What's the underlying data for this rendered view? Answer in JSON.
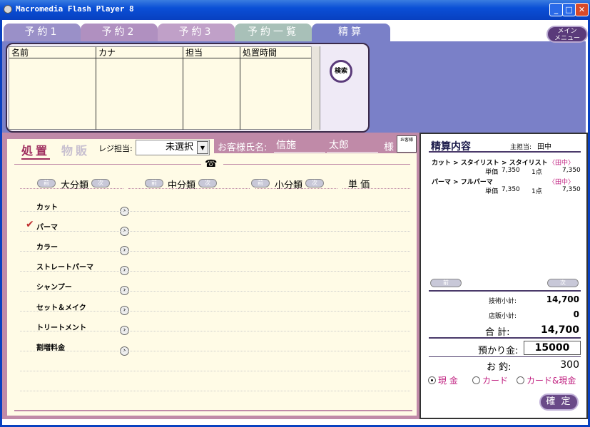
{
  "window": {
    "title": "Macromedia Flash Player 8"
  },
  "tabs": [
    "予約1",
    "予約2",
    "予約3",
    "予約一覧",
    "精算"
  ],
  "menu_button": "メイン\nメニュー",
  "reservations": {
    "columns": [
      "名前",
      "カナ",
      "担当",
      "処置時間"
    ]
  },
  "search_button": "検索",
  "mode_tabs": [
    "処置",
    "物販"
  ],
  "register": {
    "label": "レジ担当:",
    "selected": "未選択"
  },
  "customer": {
    "label": "お客様氏名:",
    "last_name": "信施",
    "first_name": "太郎",
    "suffix": "様",
    "badge": "お客様"
  },
  "categories": {
    "major": "大分類",
    "middle": "中分類",
    "minor": "小分類",
    "price": "単 価",
    "prev": "前",
    "next": "次"
  },
  "items": [
    "カット",
    "パーマ",
    "カラー",
    "ストレートパーマ",
    "シャンプー",
    "セット＆メイク",
    "トリートメント",
    "割増料金"
  ],
  "checked_item": "✔",
  "summary": {
    "title": "精算内容",
    "main_staff_label": "主担当:",
    "main_staff": "田中",
    "lines": [
      {
        "path": "カット > スタイリスト > スタイリスト",
        "staff": "〈田中〉",
        "unit_label": "単価",
        "unit": "7,350",
        "qty": "1点",
        "amount": "7,350"
      },
      {
        "path": "パーマ > フルパーマ",
        "staff": "〈田中〉",
        "unit_label": "単価",
        "unit": "7,350",
        "qty": "1点",
        "amount": "7,350"
      }
    ],
    "prev": "前",
    "next": "次",
    "tech_label": "技術小計:",
    "tech_value": "14,700",
    "retail_label": "店販小計:",
    "retail_value": "0",
    "total_label": "合 計:",
    "total_value": "14,700",
    "deposit_label": "預かり金:",
    "deposit_value": "15000",
    "change_label": "お 釣:",
    "change_value": "300",
    "payment": [
      "現 金",
      "カード",
      "カード&現金"
    ],
    "confirm": "確 定"
  }
}
